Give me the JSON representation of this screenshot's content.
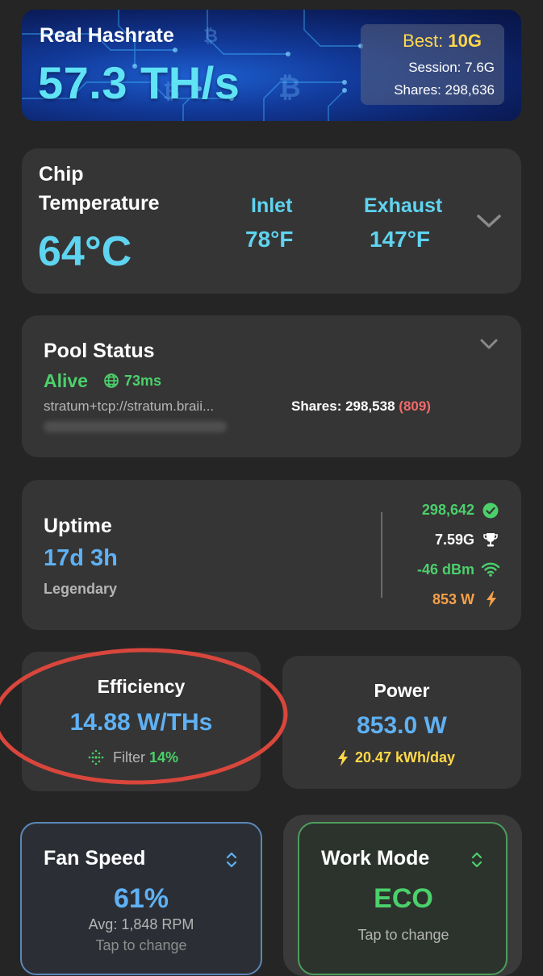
{
  "banner": {
    "title": "Real Hashrate",
    "hashrate": "57.3 TH/s",
    "best_label": "Best:",
    "best_value": "10G",
    "session_label": "Session:",
    "session_value": "7.6G",
    "shares_label": "Shares:",
    "shares_value": "298,636"
  },
  "temperature": {
    "title_line1": "Chip",
    "title_line2": "Temperature",
    "value": "64°C",
    "inlet_label": "Inlet",
    "inlet_value": "78°F",
    "exhaust_label": "Exhaust",
    "exhaust_value": "147°F"
  },
  "pool": {
    "title": "Pool Status",
    "status": "Alive",
    "latency": "73ms",
    "url": "stratum+tcp://stratum.braii...",
    "shares_label": "Shares: 298,538",
    "rejected": "(809)"
  },
  "uptime": {
    "title": "Uptime",
    "value": "17d 3h",
    "rank": "Legendary",
    "stats": [
      {
        "value": "298,642",
        "icon": "check-circle-icon"
      },
      {
        "value": "7.59G",
        "icon": "trophy-icon"
      },
      {
        "value": "-46 dBm",
        "icon": "wifi-icon"
      },
      {
        "value": "853 W",
        "icon": "bolt-icon"
      }
    ]
  },
  "efficiency": {
    "title": "Efficiency",
    "value": "14.88 W/THs",
    "filter_label": "Filter",
    "filter_value": "14%"
  },
  "power": {
    "title": "Power",
    "value": "853.0 W",
    "daily": "20.47 kWh/day"
  },
  "fan": {
    "title": "Fan Speed",
    "value": "61%",
    "avg": "Avg: 1,848 RPM",
    "hint": "Tap to change"
  },
  "work_mode": {
    "title": "Work Mode",
    "value": "ECO",
    "hint": "Tap to change"
  },
  "colors": {
    "background": "#252525",
    "card": "#353535",
    "accent_cyan": "#5fd4f0",
    "accent_blue": "#5fb1f4",
    "accent_green": "#4bd06b",
    "accent_red": "#f06a6a",
    "accent_orange": "#f6a048",
    "accent_yellow": "#ffd84a",
    "annotation_red": "#d9463c"
  }
}
